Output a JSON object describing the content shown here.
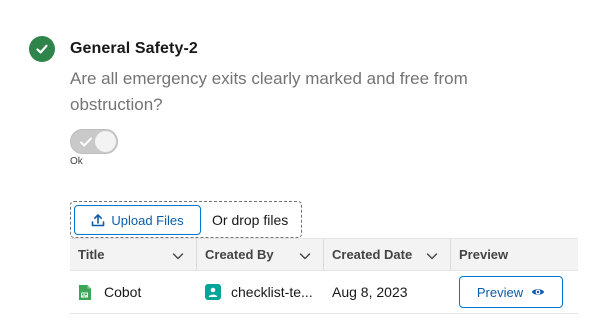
{
  "question": {
    "title": "General Safety-2",
    "text": "Are all emergency exits clearly marked and free from obstruction?",
    "status_icon": "check-circle-icon",
    "status_color": "#2e844a"
  },
  "toggle": {
    "label": "Ok",
    "checked": true
  },
  "upload": {
    "button_label": "Upload Files",
    "drop_text": "Or drop files"
  },
  "table": {
    "columns": [
      {
        "label": "Title"
      },
      {
        "label": "Created By"
      },
      {
        "label": "Created Date"
      },
      {
        "label": "Preview"
      }
    ],
    "rows": [
      {
        "title": "Cobot",
        "created_by": "checklist-te...",
        "created_date": "Aug 8, 2023",
        "preview_label": "Preview"
      }
    ]
  },
  "colors": {
    "accent": "#0176d3",
    "success": "#2e844a",
    "file_icon": "#3ba755",
    "user_icon": "#06a59a"
  }
}
